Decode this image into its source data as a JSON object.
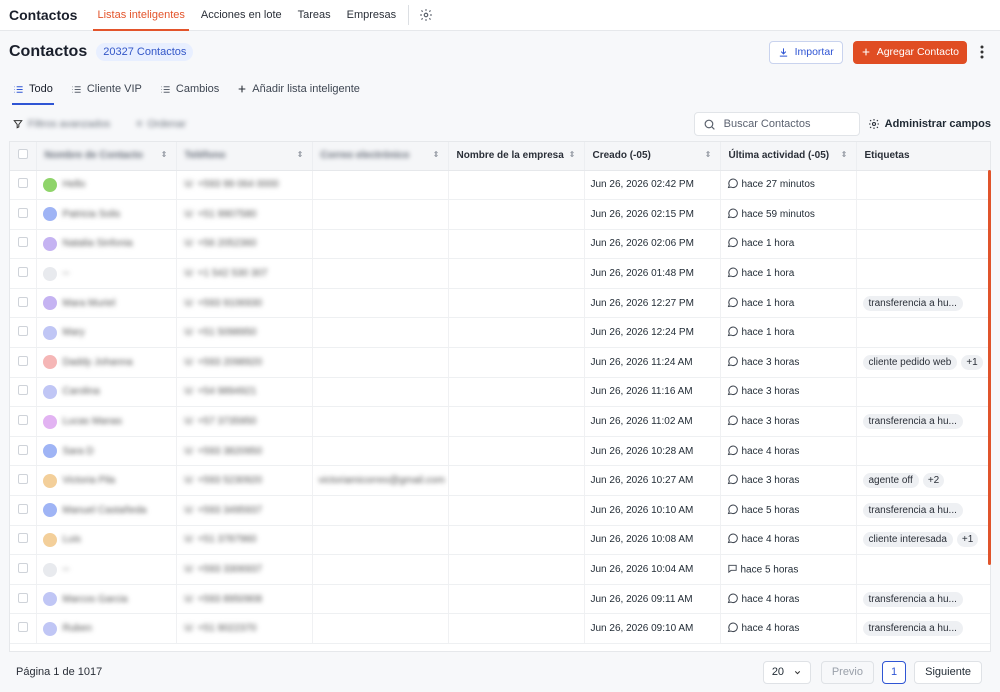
{
  "topnav": {
    "brand": "Contactos",
    "items": [
      {
        "label": "Listas inteligentes",
        "active": true
      },
      {
        "label": "Acciones en lote",
        "active": false
      },
      {
        "label": "Tareas",
        "active": false
      },
      {
        "label": "Empresas",
        "active": false
      }
    ]
  },
  "header": {
    "title": "Contactos",
    "count": "20327 Contactos",
    "import_label": "Importar",
    "add_label": "Agregar Contacto"
  },
  "tabs": [
    {
      "label": "Todo",
      "active": true
    },
    {
      "label": "Cliente VIP",
      "active": false
    },
    {
      "label": "Cambios",
      "active": false
    },
    {
      "label": "Añadir lista inteligente",
      "active": false
    }
  ],
  "toolbar": {
    "filters_label": "Filtros avanzados",
    "sort_label": "Ordenar",
    "search_placeholder": "Buscar Contactos",
    "manage_label": "Administrar campos"
  },
  "table": {
    "columns": [
      "Nombre de Contacto",
      "Teléfono",
      "Correo electrónico",
      "Nombre de la empresa",
      "Creado (-05)",
      "Última actividad (-05)",
      "Etiquetas"
    ],
    "rows": [
      {
        "name": "Hello",
        "phone": "+593 99 064 0000",
        "email": "",
        "created": "Jun 26, 2026  02:42 PM",
        "activity": "hace 27 minutos",
        "tags": [],
        "more": "",
        "avatar": "#8fd46a",
        "act": "chat"
      },
      {
        "name": "Patricia Solis",
        "phone": "+51 9907580",
        "email": "",
        "created": "Jun 26, 2026  02:15 PM",
        "activity": "hace 59 minutos",
        "tags": [],
        "more": "",
        "avatar": "#9fb4f5",
        "act": "chat"
      },
      {
        "name": "Natalia Sinfonia",
        "phone": "+56 2052360",
        "email": "",
        "created": "Jun 26, 2026  02:06 PM",
        "activity": "hace 1 hora",
        "tags": [],
        "more": "",
        "avatar": "#c5b3f2",
        "act": "chat"
      },
      {
        "name": "--",
        "phone": "+1 542 530 307",
        "email": "",
        "created": "Jun 26, 2026  01:48 PM",
        "activity": "hace 1 hora",
        "tags": [],
        "more": "",
        "avatar": "#e8eaee",
        "act": "chat"
      },
      {
        "name": "Mara Muriel",
        "phone": "+593 9106930",
        "email": "",
        "created": "Jun 26, 2026  12:27 PM",
        "activity": "hace 1 hora",
        "tags": [
          "transferencia a hu..."
        ],
        "more": "",
        "avatar": "#c5b3f2",
        "act": "chat"
      },
      {
        "name": "Mary",
        "phone": "+51 5098950",
        "email": "",
        "created": "Jun 26, 2026  12:24 PM",
        "activity": "hace 1 hora",
        "tags": [],
        "more": "",
        "avatar": "#c0c6f5",
        "act": "chat"
      },
      {
        "name": "Daddy Johanna",
        "phone": "+593 2098920",
        "email": "",
        "created": "Jun 26, 2026  11:24 AM",
        "activity": "hace 3 horas",
        "tags": [
          "cliente pedido web"
        ],
        "more": "+1",
        "avatar": "#f5b6b6",
        "act": "chat"
      },
      {
        "name": "Carolina",
        "phone": "+54 9894921",
        "email": "",
        "created": "Jun 26, 2026  11:16 AM",
        "activity": "hace 3 horas",
        "tags": [],
        "more": "",
        "avatar": "#c0c6f5",
        "act": "chat"
      },
      {
        "name": "Lucas Manas",
        "phone": "+57 3735950",
        "email": "",
        "created": "Jun 26, 2026  11:02 AM",
        "activity": "hace 3 horas",
        "tags": [
          "transferencia a hu..."
        ],
        "more": "",
        "avatar": "#e2b3f2",
        "act": "chat"
      },
      {
        "name": "Sara D",
        "phone": "+593 3820950",
        "email": "",
        "created": "Jun 26, 2026  10:28 AM",
        "activity": "hace 4 horas",
        "tags": [],
        "more": "",
        "avatar": "#9fb4f5",
        "act": "chat"
      },
      {
        "name": "Victoria Pila",
        "phone": "+593 5230920",
        "email": "victoriamicorreo@gmail.com",
        "created": "Jun 26, 2026  10:27 AM",
        "activity": "hace 3 horas",
        "tags": [
          "agente off"
        ],
        "more": "+2",
        "avatar": "#f3cf9a",
        "act": "chat"
      },
      {
        "name": "Manuel Castañeda",
        "phone": "+593 3495937",
        "email": "",
        "created": "Jun 26, 2026  10:10 AM",
        "activity": "hace 5 horas",
        "tags": [
          "transferencia a hu..."
        ],
        "more": "",
        "avatar": "#9fb4f5",
        "act": "chat"
      },
      {
        "name": "Luis",
        "phone": "+51 3787960",
        "email": "",
        "created": "Jun 26, 2026  10:08 AM",
        "activity": "hace 4 horas",
        "tags": [
          "cliente interesada"
        ],
        "more": "+1",
        "avatar": "#f3cf9a",
        "act": "chat"
      },
      {
        "name": "--",
        "phone": "+593 3306937",
        "email": "",
        "created": "Jun 26, 2026  10:04 AM",
        "activity": "hace 5 horas",
        "tags": [],
        "more": "",
        "avatar": "#e8eaee",
        "act": "msg"
      },
      {
        "name": "Marcos Garcia",
        "phone": "+593 8950908",
        "email": "",
        "created": "Jun 26, 2026  09:11 AM",
        "activity": "hace 4 horas",
        "tags": [
          "transferencia a hu..."
        ],
        "more": "",
        "avatar": "#c0c6f5",
        "act": "chat"
      },
      {
        "name": "Ruben",
        "phone": "+51 9022370",
        "email": "",
        "created": "Jun 26, 2026  09:10 AM",
        "activity": "hace 4 horas",
        "tags": [
          "transferencia a hu..."
        ],
        "more": "",
        "avatar": "#c0c6f5",
        "act": "chat"
      }
    ]
  },
  "footer": {
    "page_info": "Página 1 de 1017",
    "page_size": "20",
    "prev_label": "Previo",
    "current_page": "1",
    "next_label": "Siguiente"
  }
}
